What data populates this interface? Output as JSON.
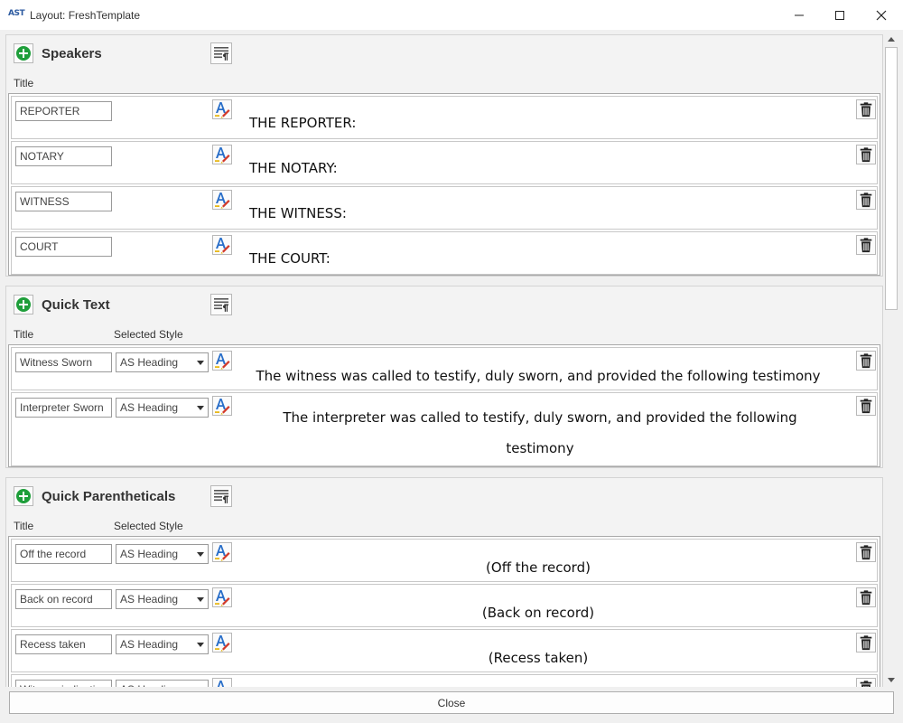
{
  "window": {
    "logo": "AST",
    "title": "Layout: FreshTemplate",
    "minimize": "—",
    "maximize": "☐",
    "close": "✕"
  },
  "speakers": {
    "title": "Speakers",
    "col_title": "Title",
    "rows": [
      {
        "title": "REPORTER",
        "preview": "THE REPORTER:"
      },
      {
        "title": "NOTARY",
        "preview": "THE NOTARY:"
      },
      {
        "title": "WITNESS",
        "preview": "THE WITNESS:"
      },
      {
        "title": "COURT",
        "preview": "THE COURT:"
      }
    ]
  },
  "quick_text": {
    "title": "Quick Text",
    "col_title": "Title",
    "col_style": "Selected Style",
    "rows": [
      {
        "title": "Witness Sworn",
        "style": "AS Heading",
        "preview": "The witness was called to testify, duly sworn, and provided the following testimony"
      },
      {
        "title": "Interpreter Sworn",
        "style": "AS Heading",
        "preview": "The interpreter was called to testify, duly sworn, and provided the following testimony"
      }
    ]
  },
  "quick_parentheticals": {
    "title": "Quick Parentheticals",
    "col_title": "Title",
    "col_style": "Selected Style",
    "rows": [
      {
        "title": "Off the record",
        "style": "AS Heading",
        "preview": "(Off the record)"
      },
      {
        "title": "Back on record",
        "style": "AS Heading",
        "preview": "(Back on record)"
      },
      {
        "title": "Recess taken",
        "style": "AS Heading",
        "preview": "(Recess taken)"
      },
      {
        "title": "Witness indicating",
        "style": "AS Heading",
        "preview": ""
      }
    ]
  },
  "footer": {
    "close_label": "Close"
  },
  "icons": {
    "add": "add-icon",
    "paragraph": "paragraph-icon",
    "font": "font-style-icon",
    "trash": "trash-icon"
  },
  "colors": {
    "add_green": "#1e9e3a",
    "font_icon_blue": "#2a6fc9",
    "pen_red": "#d23a2a",
    "pen_yellow": "#e8b81a"
  }
}
